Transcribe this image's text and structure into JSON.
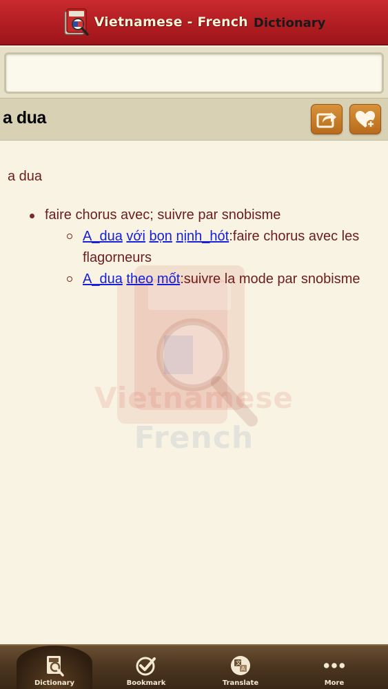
{
  "header": {
    "title_main": "Vietnamese - French",
    "title_sub": "Dictionary",
    "brand_color": "#b11d22"
  },
  "search": {
    "value": "",
    "placeholder": ""
  },
  "word": {
    "title": "a dua"
  },
  "entry": {
    "headword": "a dua",
    "definitions": [
      {
        "text": "faire chorus avec; suivre par snobisme",
        "examples": [
          {
            "links": [
              "A_dua",
              "với",
              "bọn",
              "nịnh_hót"
            ],
            "translation": ":faire chorus avec les flagorneurs"
          },
          {
            "links": [
              "A_dua",
              "theo",
              "mốt"
            ],
            "translation": ":suivre la mode par snobisme"
          }
        ]
      }
    ]
  },
  "watermark": {
    "line1": "Vietnamese",
    "line2": "French"
  },
  "tabs": [
    {
      "label": "Dictionary",
      "icon": "dictionary-icon",
      "active": true
    },
    {
      "label": "Bookmark",
      "icon": "bookmark-check-icon",
      "active": false
    },
    {
      "label": "Translate",
      "icon": "translate-icon",
      "active": false
    },
    {
      "label": "More",
      "icon": "more-dots-icon",
      "active": false
    }
  ],
  "colors": {
    "accent_orange": "#c97a25",
    "link_blue": "#1620d8",
    "text_maroon": "#6b1d1d",
    "tabbar_brown": "#4b3520"
  }
}
